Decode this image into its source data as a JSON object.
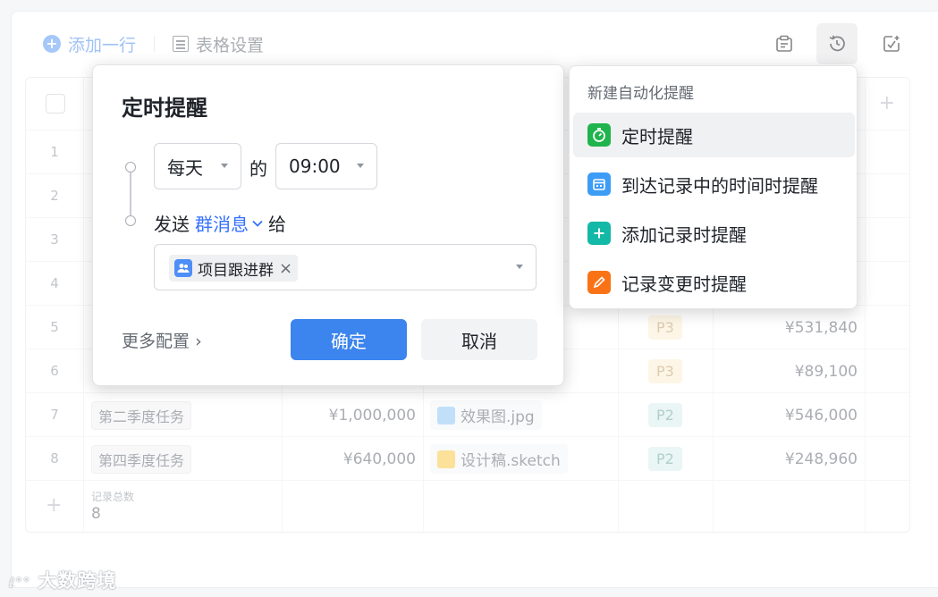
{
  "toolbar": {
    "add_row_label": "添加一行",
    "table_settings_label": "表格设置"
  },
  "table": {
    "row_numbers": [
      "1",
      "2",
      "3",
      "4",
      "5",
      "6",
      "7",
      "8"
    ],
    "visible_rows": [
      {
        "num": "5",
        "task": "",
        "amount": "",
        "file": "",
        "priority": "P3",
        "total": "¥531,840"
      },
      {
        "num": "6",
        "task": "",
        "amount": "",
        "file": "",
        "priority": "P3",
        "total": "¥89,100"
      },
      {
        "num": "7",
        "task": "第二季度任务",
        "amount": "¥1,000,000",
        "file": "效果图.jpg",
        "priority": "P2",
        "total": "¥546,000"
      },
      {
        "num": "8",
        "task": "第四季度任务",
        "amount": "¥640,000",
        "file": "设计稿.sketch",
        "priority": "P2",
        "total": "¥248,960"
      }
    ],
    "footer_label": "记录总数",
    "footer_value": "8"
  },
  "popup": {
    "title": "定时提醒",
    "frequency": "每天",
    "connector": "的",
    "time": "09:00",
    "send_prefix": "发送",
    "send_type": "群消息",
    "send_suffix": "给",
    "recipient": "项目跟进群",
    "more_config": "更多配置",
    "confirm": "确定",
    "cancel": "取消"
  },
  "menu": {
    "header": "新建自动化提醒",
    "items": [
      {
        "label": "定时提醒",
        "icon": "timer-icon",
        "color": "#1fb44d"
      },
      {
        "label": "到达记录中的时间时提醒",
        "icon": "calendar-icon",
        "color": "#3d9cf5"
      },
      {
        "label": "添加记录时提醒",
        "icon": "plus-icon",
        "color": "#14b8a6"
      },
      {
        "label": "记录变更时提醒",
        "icon": "pencil-icon",
        "color": "#f97316"
      }
    ]
  },
  "watermark": "大数跨境",
  "colors": {
    "primary": "#3c84ee",
    "accent_link": "#3370ff"
  }
}
